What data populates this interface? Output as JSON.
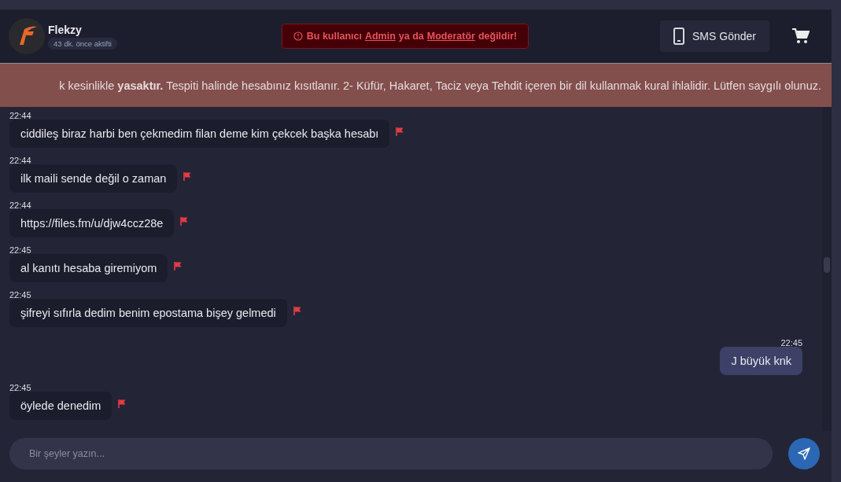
{
  "user": {
    "name": "Flekzy",
    "status": "43 dk. önce aktifti"
  },
  "alert": {
    "parts": [
      {
        "text": "Bu kullanıcı",
        "underline": false
      },
      {
        "text": "Admin",
        "underline": true
      },
      {
        "text": "ya da",
        "underline": false
      },
      {
        "text": "Moderatör",
        "underline": true
      },
      {
        "text": "değildir!",
        "underline": false
      }
    ]
  },
  "sms_button": {
    "label": "SMS Gönder"
  },
  "banner": {
    "text": "k kesinlikle **yasaktır.** Tespiti halinde hesabınız kısıtlanır. 2- Küfür, Hakaret, Taciz veya Tehdit içeren bir dil kullanmak kural ihlalidir. Lütfen saygılı olunuz."
  },
  "messages": [
    {
      "time": "22:44",
      "text": "ciddileş biraz harbi ben çekmedim filan deme kim çekcek başka hesabı",
      "kind": "incoming"
    },
    {
      "time": "22:44",
      "text": "ilk maili sende değil o zaman",
      "kind": "incoming"
    },
    {
      "time": "22:44",
      "text": "https://files.fm/u/djw4ccz28e",
      "kind": "incoming"
    },
    {
      "time": "22:45",
      "text": "al kanıtı hesaba giremiyom",
      "kind": "incoming"
    },
    {
      "time": "22:45",
      "text": "şifreyi sıfırla dedim benim epostama bişey gelmedi",
      "kind": "incoming"
    },
    {
      "time": "22:45",
      "text": "J büyük knk",
      "kind": "outgoing"
    },
    {
      "time": "22:45",
      "text": "öylede denedim",
      "kind": "incoming"
    }
  ],
  "composer": {
    "placeholder": "Bir şeyler yazın..."
  }
}
